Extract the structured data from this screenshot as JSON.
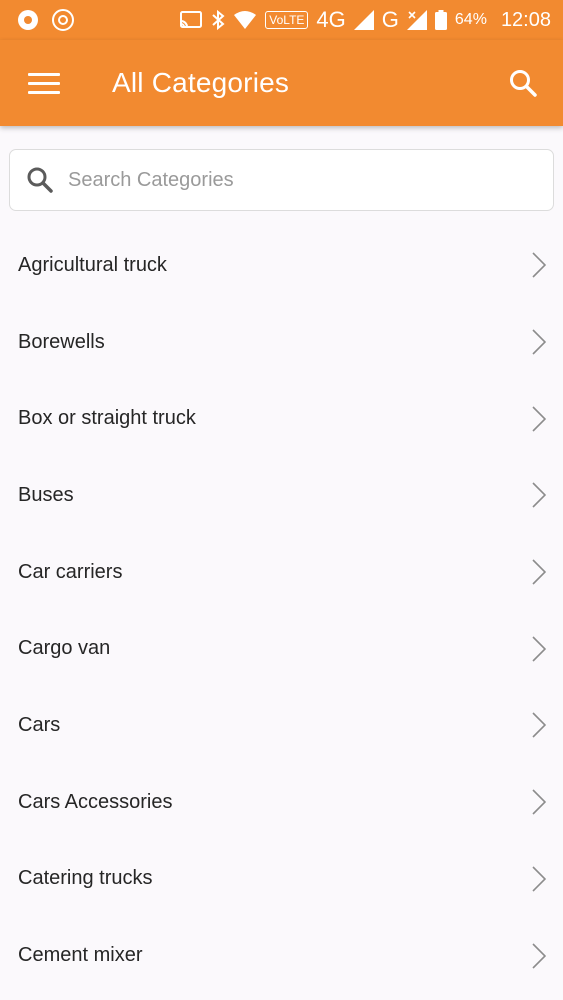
{
  "status_bar": {
    "volte": "VoLTE",
    "network_4g": "4G",
    "network_g": "G",
    "battery": "64%",
    "time": "12:08"
  },
  "app_bar": {
    "title": "All Categories",
    "menu_icon": "hamburger-menu-icon",
    "search_icon": "search-icon"
  },
  "search": {
    "placeholder": "Search Categories",
    "value": ""
  },
  "categories": [
    {
      "label": "Agricultural truck"
    },
    {
      "label": "Borewells"
    },
    {
      "label": "Box or straight truck"
    },
    {
      "label": "Buses"
    },
    {
      "label": "Car carriers"
    },
    {
      "label": "Cargo van"
    },
    {
      "label": "Cars"
    },
    {
      "label": "Cars Accessories"
    },
    {
      "label": "Catering trucks"
    },
    {
      "label": "Cement mixer"
    }
  ],
  "colors": {
    "primary": "#f28a30",
    "background": "#fbf9fc",
    "text": "#262626",
    "placeholder": "#9a9a9a"
  }
}
